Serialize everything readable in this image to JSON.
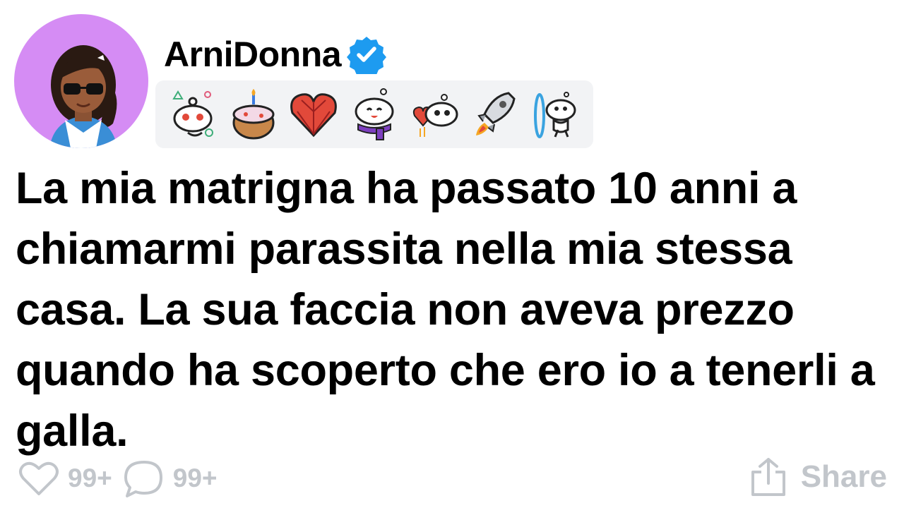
{
  "author": {
    "username": "ArniDonna",
    "verified": true,
    "avatar_bg": "#d58cf4",
    "verified_color": "#1d9bf0"
  },
  "trophies": [
    {
      "icon": "snoo-shapes-trophy-icon"
    },
    {
      "icon": "birthday-cake-trophy-icon"
    },
    {
      "icon": "gem-heart-trophy-icon"
    },
    {
      "icon": "snoo-scarf-trophy-icon"
    },
    {
      "icon": "snoo-heart-trophy-icon"
    },
    {
      "icon": "rocket-trophy-icon"
    },
    {
      "icon": "snoo-portal-trophy-icon"
    }
  ],
  "post": {
    "text": "La mia matrigna ha passato 10 anni a chiamarmi parassita nella mia stessa casa. La sua faccia non aveva prezzo quando ha scoperto che ero io a tenerli a galla."
  },
  "actions": {
    "likes": "99+",
    "comments": "99+",
    "share_label": "Share",
    "icon_color": "#c2c6cb"
  }
}
